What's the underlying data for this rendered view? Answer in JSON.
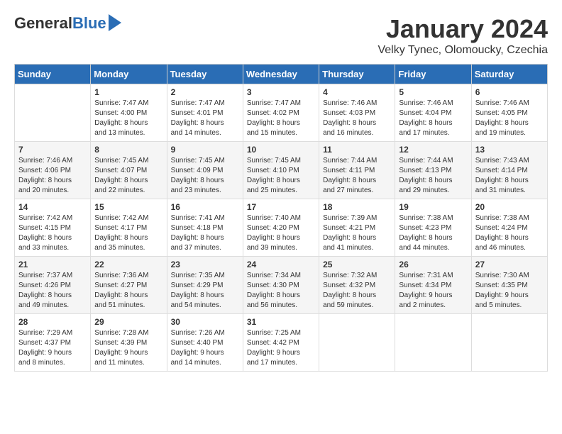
{
  "header": {
    "logo_general": "General",
    "logo_blue": "Blue",
    "month_title": "January 2024",
    "subtitle": "Velky Tynec, Olomoucky, Czechia"
  },
  "days_of_week": [
    "Sunday",
    "Monday",
    "Tuesday",
    "Wednesday",
    "Thursday",
    "Friday",
    "Saturday"
  ],
  "weeks": [
    [
      {
        "day": "",
        "data": ""
      },
      {
        "day": "1",
        "data": "Sunrise: 7:47 AM\nSunset: 4:00 PM\nDaylight: 8 hours\nand 13 minutes."
      },
      {
        "day": "2",
        "data": "Sunrise: 7:47 AM\nSunset: 4:01 PM\nDaylight: 8 hours\nand 14 minutes."
      },
      {
        "day": "3",
        "data": "Sunrise: 7:47 AM\nSunset: 4:02 PM\nDaylight: 8 hours\nand 15 minutes."
      },
      {
        "day": "4",
        "data": "Sunrise: 7:46 AM\nSunset: 4:03 PM\nDaylight: 8 hours\nand 16 minutes."
      },
      {
        "day": "5",
        "data": "Sunrise: 7:46 AM\nSunset: 4:04 PM\nDaylight: 8 hours\nand 17 minutes."
      },
      {
        "day": "6",
        "data": "Sunrise: 7:46 AM\nSunset: 4:05 PM\nDaylight: 8 hours\nand 19 minutes."
      }
    ],
    [
      {
        "day": "7",
        "data": "Sunrise: 7:46 AM\nSunset: 4:06 PM\nDaylight: 8 hours\nand 20 minutes."
      },
      {
        "day": "8",
        "data": "Sunrise: 7:45 AM\nSunset: 4:07 PM\nDaylight: 8 hours\nand 22 minutes."
      },
      {
        "day": "9",
        "data": "Sunrise: 7:45 AM\nSunset: 4:09 PM\nDaylight: 8 hours\nand 23 minutes."
      },
      {
        "day": "10",
        "data": "Sunrise: 7:45 AM\nSunset: 4:10 PM\nDaylight: 8 hours\nand 25 minutes."
      },
      {
        "day": "11",
        "data": "Sunrise: 7:44 AM\nSunset: 4:11 PM\nDaylight: 8 hours\nand 27 minutes."
      },
      {
        "day": "12",
        "data": "Sunrise: 7:44 AM\nSunset: 4:13 PM\nDaylight: 8 hours\nand 29 minutes."
      },
      {
        "day": "13",
        "data": "Sunrise: 7:43 AM\nSunset: 4:14 PM\nDaylight: 8 hours\nand 31 minutes."
      }
    ],
    [
      {
        "day": "14",
        "data": "Sunrise: 7:42 AM\nSunset: 4:15 PM\nDaylight: 8 hours\nand 33 minutes."
      },
      {
        "day": "15",
        "data": "Sunrise: 7:42 AM\nSunset: 4:17 PM\nDaylight: 8 hours\nand 35 minutes."
      },
      {
        "day": "16",
        "data": "Sunrise: 7:41 AM\nSunset: 4:18 PM\nDaylight: 8 hours\nand 37 minutes."
      },
      {
        "day": "17",
        "data": "Sunrise: 7:40 AM\nSunset: 4:20 PM\nDaylight: 8 hours\nand 39 minutes."
      },
      {
        "day": "18",
        "data": "Sunrise: 7:39 AM\nSunset: 4:21 PM\nDaylight: 8 hours\nand 41 minutes."
      },
      {
        "day": "19",
        "data": "Sunrise: 7:38 AM\nSunset: 4:23 PM\nDaylight: 8 hours\nand 44 minutes."
      },
      {
        "day": "20",
        "data": "Sunrise: 7:38 AM\nSunset: 4:24 PM\nDaylight: 8 hours\nand 46 minutes."
      }
    ],
    [
      {
        "day": "21",
        "data": "Sunrise: 7:37 AM\nSunset: 4:26 PM\nDaylight: 8 hours\nand 49 minutes."
      },
      {
        "day": "22",
        "data": "Sunrise: 7:36 AM\nSunset: 4:27 PM\nDaylight: 8 hours\nand 51 minutes."
      },
      {
        "day": "23",
        "data": "Sunrise: 7:35 AM\nSunset: 4:29 PM\nDaylight: 8 hours\nand 54 minutes."
      },
      {
        "day": "24",
        "data": "Sunrise: 7:34 AM\nSunset: 4:30 PM\nDaylight: 8 hours\nand 56 minutes."
      },
      {
        "day": "25",
        "data": "Sunrise: 7:32 AM\nSunset: 4:32 PM\nDaylight: 8 hours\nand 59 minutes."
      },
      {
        "day": "26",
        "data": "Sunrise: 7:31 AM\nSunset: 4:34 PM\nDaylight: 9 hours\nand 2 minutes."
      },
      {
        "day": "27",
        "data": "Sunrise: 7:30 AM\nSunset: 4:35 PM\nDaylight: 9 hours\nand 5 minutes."
      }
    ],
    [
      {
        "day": "28",
        "data": "Sunrise: 7:29 AM\nSunset: 4:37 PM\nDaylight: 9 hours\nand 8 minutes."
      },
      {
        "day": "29",
        "data": "Sunrise: 7:28 AM\nSunset: 4:39 PM\nDaylight: 9 hours\nand 11 minutes."
      },
      {
        "day": "30",
        "data": "Sunrise: 7:26 AM\nSunset: 4:40 PM\nDaylight: 9 hours\nand 14 minutes."
      },
      {
        "day": "31",
        "data": "Sunrise: 7:25 AM\nSunset: 4:42 PM\nDaylight: 9 hours\nand 17 minutes."
      },
      {
        "day": "",
        "data": ""
      },
      {
        "day": "",
        "data": ""
      },
      {
        "day": "",
        "data": ""
      }
    ]
  ]
}
